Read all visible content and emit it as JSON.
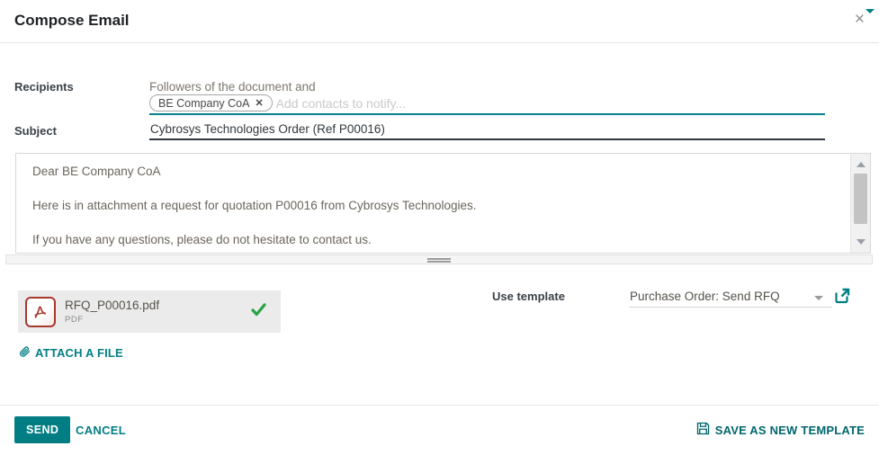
{
  "dialog": {
    "title": "Compose Email"
  },
  "icons": {
    "close": "×",
    "tag_remove": "✕"
  },
  "recipients": {
    "label": "Recipients",
    "followers_text": "Followers of the document and",
    "tag": "BE Company CoA",
    "placeholder": "Add contacts to notify..."
  },
  "subject": {
    "label": "Subject",
    "value": "Cybrosys Technologies Order (Ref P00016)"
  },
  "body": {
    "paragraphs": [
      "Dear BE Company CoA",
      "Here is in attachment a request for quotation P00016 from Cybrosys Technologies.",
      "If you have any questions, please do not hesitate to contact us."
    ]
  },
  "attachment": {
    "filename": "RFQ_P00016.pdf",
    "filetype": "PDF"
  },
  "template": {
    "label": "Use template",
    "value": "Purchase Order: Send RFQ"
  },
  "actions": {
    "attach_file": "ATTACH A FILE",
    "send": "SEND",
    "cancel": "CANCEL",
    "save_as_template": "SAVE AS NEW TEMPLATE"
  },
  "colors": {
    "accent_teal": "#017e84",
    "subject_underline": "#30363d",
    "pdf_red": "#a8382d",
    "check_green": "#28a344",
    "attachment_bg": "#ebebeb"
  }
}
